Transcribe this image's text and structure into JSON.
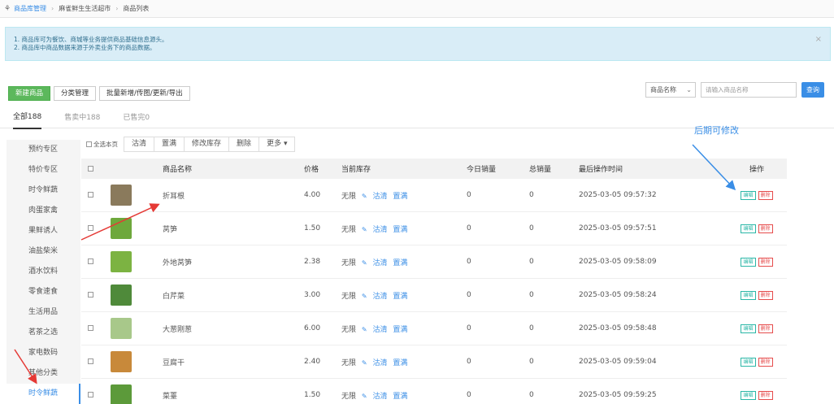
{
  "breadcrumb": [
    "商品库管理",
    "麻雀鲜生生活超市",
    "商品列表"
  ],
  "notice": {
    "line1": "1. 商品库可为餐饮、商城等业务提供商品基础信息源头。",
    "line2": "2. 商品库中商品数据来源于外卖业务下的商品数据。",
    "close": "×"
  },
  "toolbar": {
    "new": "新建商品",
    "category": "分类管理",
    "batch": "批量新增/传图/更新/导出"
  },
  "search": {
    "field": "商品名称",
    "placeholder": "请输入商品名称",
    "button": "查询"
  },
  "tabs": [
    "全部188",
    "售卖中188",
    "已售完0"
  ],
  "sidebar": [
    "预约专区",
    "特价专区",
    "时令鲜蔬",
    "肉蛋家禽",
    "果鲜诱人",
    "油盐柴米",
    "酒水饮料",
    "零食速食",
    "生活用品",
    "茗茶之选",
    "家电数码",
    "其他分类",
    "时令鲜蔬"
  ],
  "actions": {
    "select_page": "全选本页",
    "clear": "沽清",
    "fill": "置满",
    "edit_stock": "修改库存",
    "delete": "删除",
    "more": "更多"
  },
  "columns": {
    "name": "商品名称",
    "price": "价格",
    "stock": "当前库存",
    "today": "今日销量",
    "total": "总销量",
    "time": "最后操作时间",
    "op": "操作"
  },
  "stock_labels": {
    "unlimited": "无限",
    "clear": "沽清",
    "fill": "置满"
  },
  "op_labels": {
    "edit": "编辑",
    "delete": "删除"
  },
  "rows": [
    {
      "name": "折耳根",
      "price": "4.00",
      "today": "0",
      "total": "0",
      "time": "2025-03-05 09:57:32",
      "color": "#8a7a5c"
    },
    {
      "name": "莴笋",
      "price": "1.50",
      "today": "0",
      "total": "0",
      "time": "2025-03-05 09:57:51",
      "color": "#6ea83c"
    },
    {
      "name": "外地莴笋",
      "price": "2.38",
      "today": "0",
      "total": "0",
      "time": "2025-03-05 09:58:09",
      "color": "#7cb342"
    },
    {
      "name": "白芹菜",
      "price": "3.00",
      "today": "0",
      "total": "0",
      "time": "2025-03-05 09:58:24",
      "color": "#4f8a3a"
    },
    {
      "name": "大葱刚葱",
      "price": "6.00",
      "today": "0",
      "total": "0",
      "time": "2025-03-05 09:58:48",
      "color": "#a8c88a"
    },
    {
      "name": "豆腐干",
      "price": "2.40",
      "today": "0",
      "total": "0",
      "time": "2025-03-05 09:59:04",
      "color": "#c8893a"
    },
    {
      "name": "菜薹",
      "price": "1.50",
      "today": "0",
      "total": "0",
      "time": "2025-03-05 09:59:25",
      "color": "#5c9a3a"
    }
  ],
  "annotation": "后期可修改",
  "colors": {
    "accent": "#3a8ee6",
    "green": "#5cb85c",
    "arrow_red": "#e53935",
    "arrow_blue": "#3a8ee6"
  }
}
